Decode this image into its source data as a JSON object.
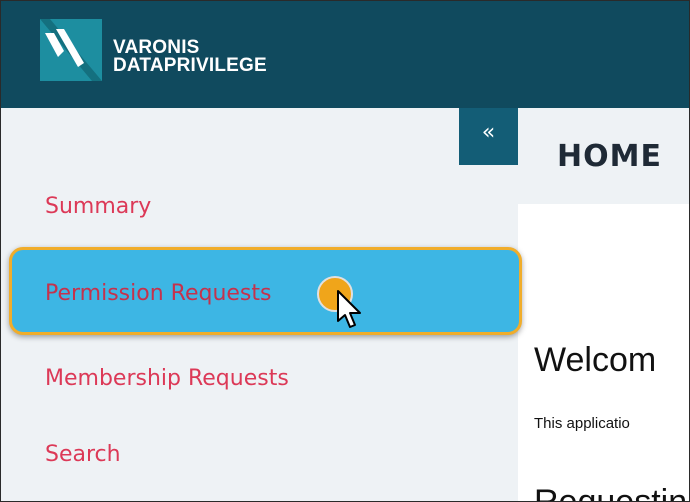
{
  "header": {
    "brand_line1": "VARONIS",
    "brand_line2": "DATAPRIVILEGE",
    "bg_color": "#104a5e"
  },
  "sidebar": {
    "collapse_glyph": "«",
    "items": [
      {
        "label": "Summary"
      },
      {
        "label": "Permission Requests",
        "active": true
      },
      {
        "label": "Membership Requests"
      },
      {
        "label": "Search"
      }
    ],
    "link_color": "#dc3957",
    "active_bg": "#3db6e4",
    "highlight_color": "#f0ad2b"
  },
  "main": {
    "page_title": "HOME",
    "welcome": "Welcom",
    "intro_text": "This applicatio",
    "next_heading": "Requestin"
  },
  "icons": [
    "varonis-logo-icon",
    "collapse-icon",
    "mouse-cursor-icon"
  ]
}
